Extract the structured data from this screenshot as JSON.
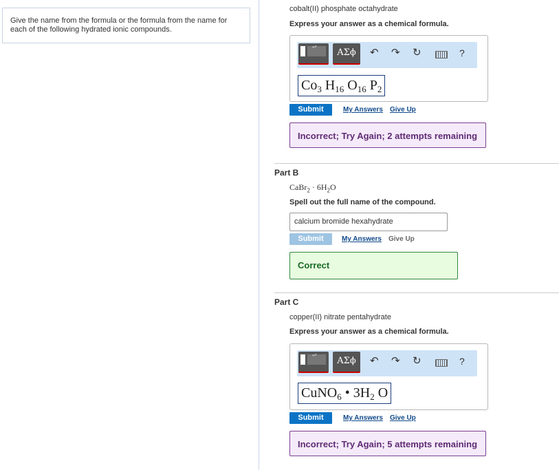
{
  "intro": "Give the name from the formula or the formula from the name for each of the following hydrated ionic compounds.",
  "editor_toolbar": {
    "symbols_label": "ΑΣϕ",
    "help_label": "?"
  },
  "part_a": {
    "question": "cobalt(II) phosphate octahydrate",
    "instruction": "Express your answer as a chemical formula.",
    "answer_parts": [
      "Co",
      "3",
      " H",
      "16",
      " O",
      "16",
      " P",
      "2"
    ],
    "submit": "Submit",
    "my_answers": "My Answers",
    "give_up": "Give Up",
    "feedback": "Incorrect; Try Again; 2 attempts remaining"
  },
  "part_b": {
    "title": "Part B",
    "formula_parts": [
      "CaBr",
      "2",
      " · 6H",
      "2",
      "O"
    ],
    "instruction": "Spell out the full name of the compound.",
    "answer_value": "calcium bromide hexahydrate",
    "submit": "Submit",
    "my_answers": "My Answers",
    "give_up": "Give Up",
    "feedback": "Correct"
  },
  "part_c": {
    "title": "Part C",
    "question": "copper(II) nitrate pentahydrate",
    "instruction": "Express your answer as a chemical formula.",
    "answer_parts": [
      "CuNO",
      "6",
      " • 3H",
      "2",
      " O"
    ],
    "submit": "Submit",
    "my_answers": "My Answers",
    "give_up": "Give Up",
    "feedback": "Incorrect; Try Again; 5 attempts remaining"
  }
}
